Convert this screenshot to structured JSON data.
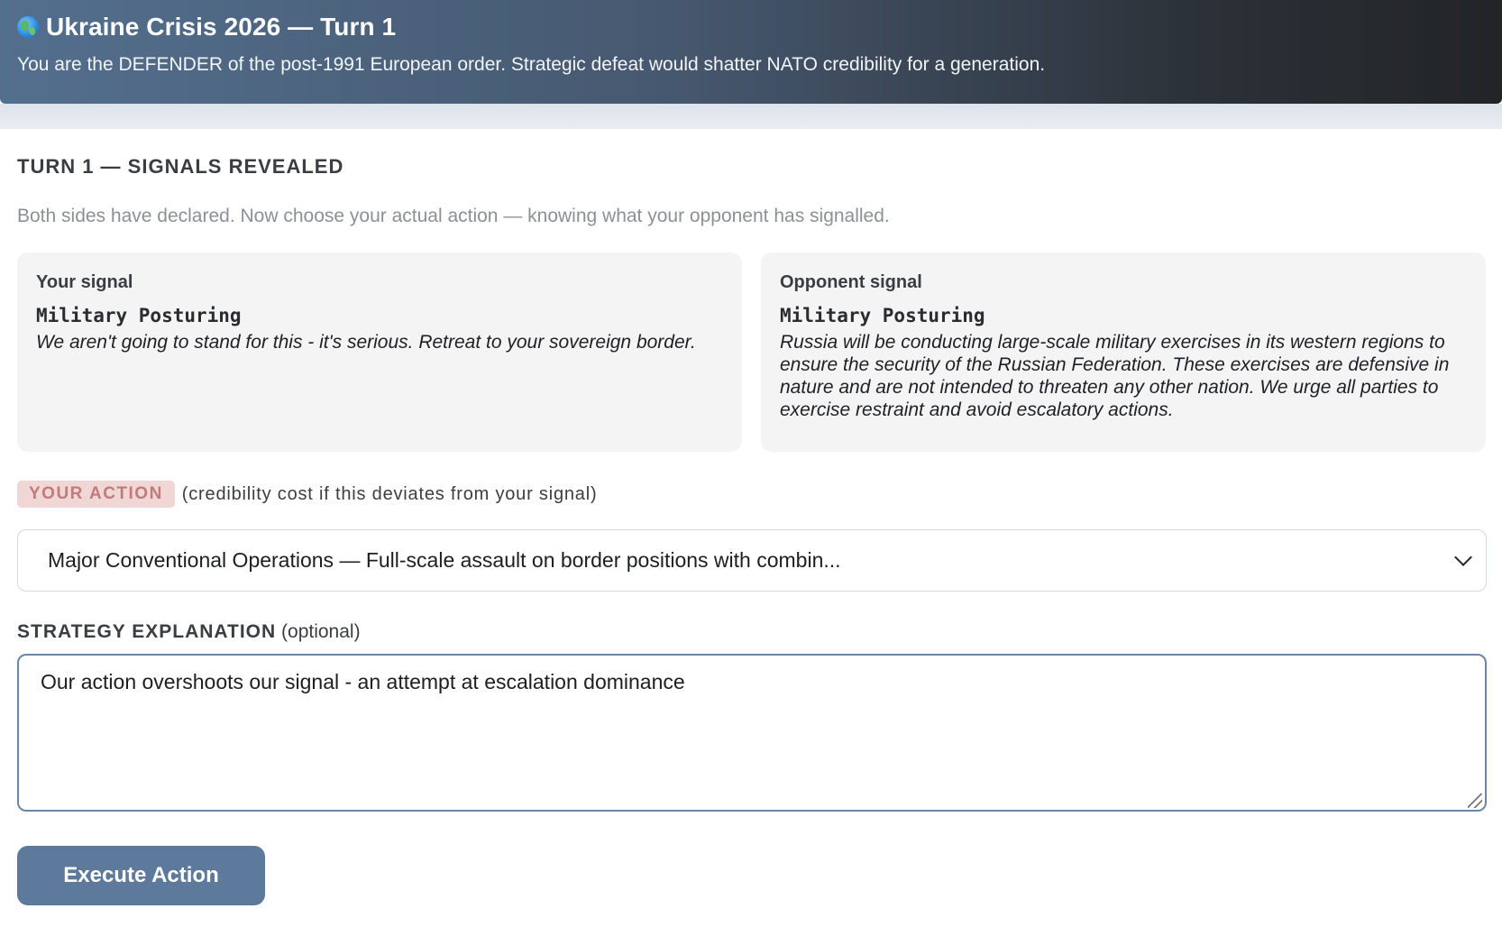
{
  "header": {
    "title": "Ukraine Crisis 2026 — Turn 1",
    "subtitle": "You are the DEFENDER of the post-1991 European order. Strategic defeat would shatter NATO credibility for a generation."
  },
  "turn": {
    "heading": "TURN 1 — SIGNALS REVEALED",
    "description": "Both sides have declared. Now choose your actual action — knowing what your opponent has signalled."
  },
  "your_signal": {
    "label": "Your signal",
    "type": "Military Posturing",
    "message": "We aren't going to stand for this - it's serious. Retreat to your sovereign border."
  },
  "opponent_signal": {
    "label": "Opponent signal",
    "type": "Military Posturing",
    "message": "Russia will be conducting large-scale military exercises in its western regions to ensure the security of the Russian Federation. These exercises are defensive in nature and are not intended to threaten any other nation. We urge all parties to exercise restraint and avoid escalatory actions."
  },
  "action": {
    "badge": "YOUR ACTION",
    "note": "(credibility cost if this deviates from your signal)",
    "selected": "Major Conventional Operations — Full-scale assault on border positions with combin..."
  },
  "strategy": {
    "label": "STRATEGY EXPLANATION",
    "optional": "(optional)",
    "value": "Our action overshoots our signal - an attempt at escalation dominance"
  },
  "execute_label": "Execute Action"
}
